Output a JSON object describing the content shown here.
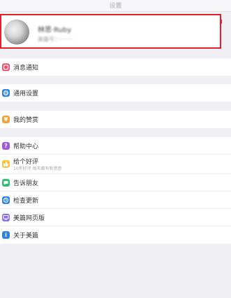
{
  "nav": {
    "title": "设置"
  },
  "profile": {
    "name": "林思·Ruby",
    "id_text": "美篇号：·········"
  },
  "groups": [
    {
      "items": [
        {
          "label": "消息通知",
          "icon": "bell-icon",
          "color": "#f0506e",
          "glyph": ""
        }
      ]
    },
    {
      "items": [
        {
          "label": "通用设置",
          "icon": "gear-icon",
          "color": "#2f82e0",
          "glyph": "⚙"
        }
      ]
    },
    {
      "items": [
        {
          "label": "我的赞赏",
          "icon": "yen-icon",
          "color": "#f0a23c",
          "glyph": "¥"
        }
      ]
    },
    {
      "items": [
        {
          "label": "帮助中心",
          "icon": "question-icon",
          "color": "#a05ad8",
          "glyph": "?"
        },
        {
          "label": "给个好评",
          "sub": "10年好评 每天都有新意思",
          "icon": "thumb-icon",
          "color": "#f3c43a",
          "glyph": ""
        },
        {
          "label": "告诉朋友",
          "icon": "share-icon",
          "color": "#2fbf71",
          "glyph": ""
        },
        {
          "label": "检查更新",
          "icon": "update-icon",
          "color": "#2f82e0",
          "glyph": ""
        },
        {
          "label": "美篇网页版",
          "icon": "monitor-icon",
          "color": "#8a6ee0",
          "glyph": ""
        },
        {
          "label": "关于美篇",
          "icon": "info-icon",
          "color": "#2f82e0",
          "glyph": "i"
        }
      ]
    }
  ]
}
